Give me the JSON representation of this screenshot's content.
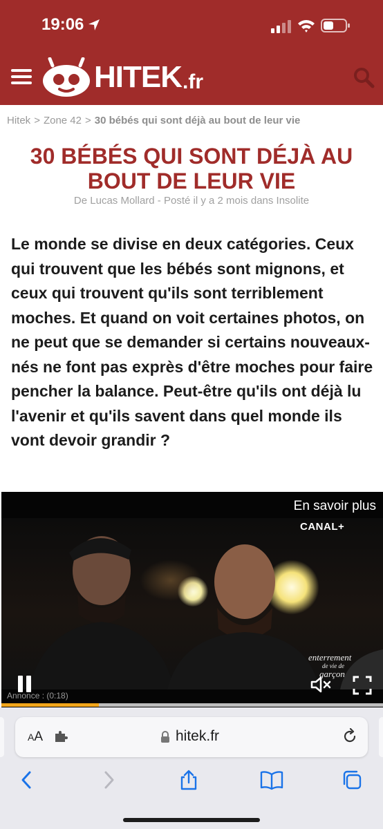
{
  "status_bar": {
    "time": "19:06",
    "icons": [
      "location-arrow-icon",
      "signal-icon",
      "wifi-icon",
      "battery-icon"
    ]
  },
  "header": {
    "logo_text": "HITEK",
    "logo_tld": ".fr",
    "menu_icon": "hamburger-menu-icon",
    "search_icon": "search-icon",
    "brand_color": "#a02c2a"
  },
  "breadcrumb": {
    "items": [
      "Hitek",
      "Zone 42"
    ],
    "separator": ">",
    "current": "30 bébés qui sont déjà au bout de leur vie"
  },
  "article": {
    "title": "30 BÉBÉS QUI SONT DÉJÀ AU BOUT DE LEUR VIE",
    "byline": "De Lucas Mollard - Posté il y a 2 mois dans Insolite",
    "intro": "Le monde se divise en deux catégories. Ceux qui trouvent que les bébés sont mignons, et ceux qui trouvent qu'ils sont terriblement moches. Et quand on voit certaines photos, on ne peut que se demander si certains nouveaux-nés ne font pas exprès d'être moches pour faire pencher la balance. Peut-être qu'ils ont déjà lu l'avenir et qu'ils savent dans quel monde ils vont devoir grandir ?"
  },
  "video_ad": {
    "learn_more": "En savoir plus",
    "channel": "CANAL+",
    "watermark_line1": "enterrement",
    "watermark_line2": "de vie de",
    "watermark_line3": "garçon",
    "ad_label": "Annonce : (0:18)",
    "progress": 0.255,
    "progress_color": "#f2a51a"
  },
  "browser": {
    "text_size_label": "AA",
    "url": "hitek.fr",
    "toolbar_icons": [
      "back-icon",
      "forward-icon",
      "share-icon",
      "bookmarks-icon",
      "tabs-icon"
    ],
    "accent": "#1a73e8"
  }
}
